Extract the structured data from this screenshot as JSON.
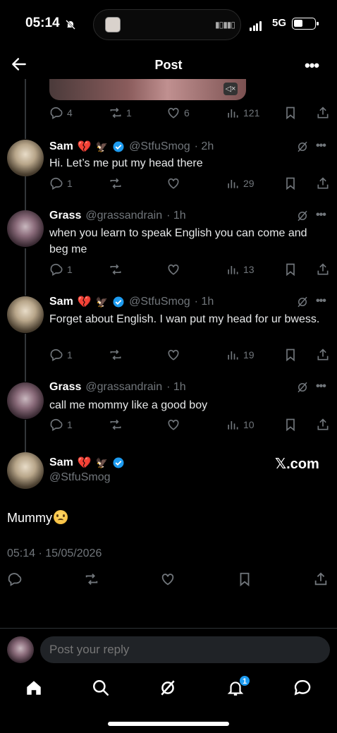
{
  "status_bar": {
    "time": "05:14",
    "network": "5G"
  },
  "header": {
    "title": "Post"
  },
  "colors": {
    "background": "#000000",
    "text": "#e7e9ea",
    "muted": "#71767b",
    "accent": "#1d9bf0",
    "heart": "#e0245e"
  },
  "prior_tweet_actions": {
    "replies": "4",
    "reposts": "1",
    "likes": "6",
    "views": "121"
  },
  "tweets": [
    {
      "name": "Sam",
      "handle": "@StfuSmog",
      "time": "· 2h",
      "text": "Hi. Let’s me put my head there",
      "replies": "1",
      "reposts": "",
      "likes": "",
      "views": "29"
    },
    {
      "name": "Grass",
      "handle": "@grassandrain",
      "time": "· 1h",
      "text": "when you learn to speak English you can come and beg me",
      "replies": "1",
      "reposts": "",
      "likes": "",
      "views": "13"
    },
    {
      "name": "Sam",
      "handle": "@StfuSmog",
      "time": "· 1h",
      "text": "Forget about English. I wan put my head for ur bwess.",
      "replies": "1",
      "reposts": "",
      "likes": "",
      "views": "19"
    },
    {
      "name": "Grass",
      "handle": "@grassandrain",
      "time": "· 1h",
      "text": "call me mommy like a good boy",
      "replies": "1",
      "reposts": "",
      "likes": "",
      "views": "10"
    }
  ],
  "main_tweet": {
    "name": "Sam",
    "handle": "@StfuSmog",
    "watermark": "𝕏.com",
    "text": "Mummy",
    "timestamp": "05:14 · 15/05/2026"
  },
  "reply_bar": {
    "placeholder": "Post your reply"
  },
  "bottom_nav": {
    "notifications_badge": "1"
  },
  "icons": [
    "back-arrow-icon",
    "more-icon",
    "reply-icon",
    "repost-icon",
    "like-icon",
    "views-icon",
    "bookmark-icon",
    "share-icon",
    "verified-icon",
    "grok-icon",
    "home-icon",
    "search-icon",
    "grok-nav-icon",
    "notifications-icon",
    "messages-icon"
  ]
}
